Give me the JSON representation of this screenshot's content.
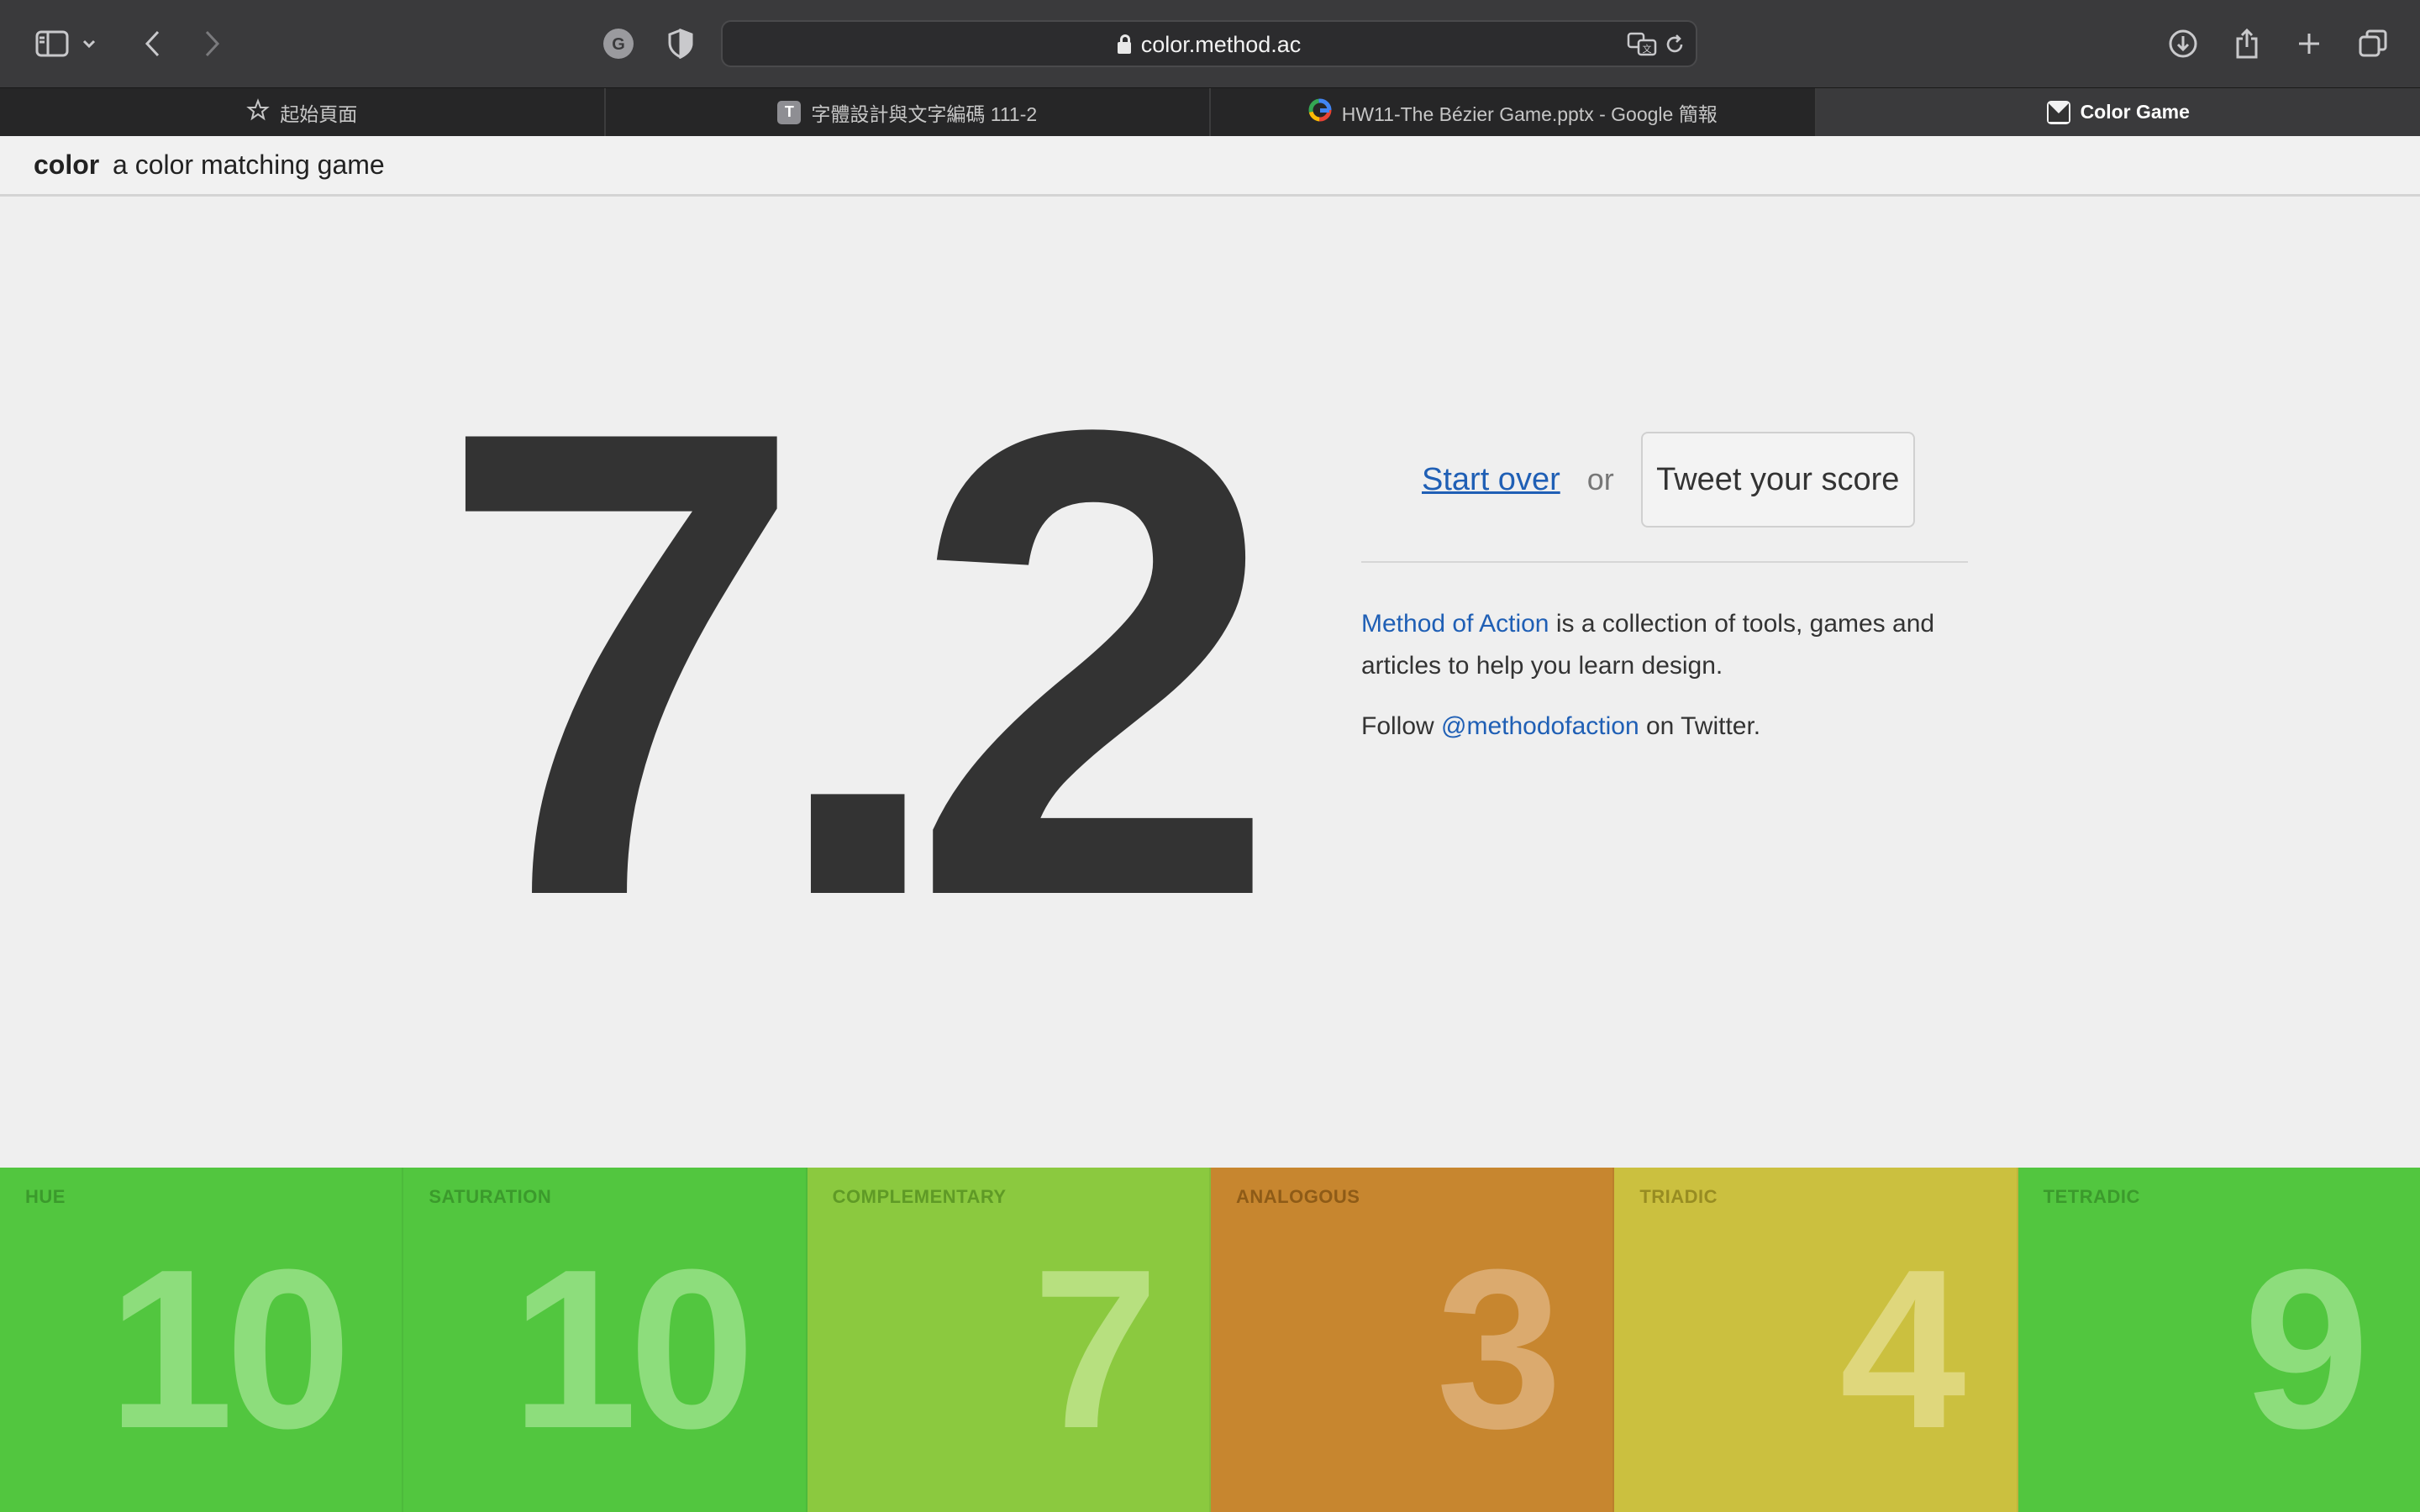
{
  "browser": {
    "url": "color.method.ac",
    "tabs": [
      {
        "label": "起始頁面",
        "icon": "star-icon",
        "active": false
      },
      {
        "label": "字體設計與文字編碼 111-2",
        "icon": "t-favicon",
        "active": false
      },
      {
        "label": "HW11-The Bézier Game.pptx - Google 簡報",
        "icon": "google-favicon",
        "active": false
      },
      {
        "label": "Color Game",
        "icon": "method-favicon",
        "active": true
      }
    ]
  },
  "header": {
    "brand": "color",
    "tagline": "a color matching game"
  },
  "score": "7.2",
  "actions": {
    "start_over": "Start over",
    "or": "or",
    "tweet": "Tweet your score"
  },
  "about": {
    "link": "Method of Action",
    "text": " is a collection of tools, games and articles to help you learn design."
  },
  "follow": {
    "prefix": "Follow ",
    "handle": "@methodofaction",
    "suffix": " on Twitter."
  },
  "tiles": [
    {
      "label": "HUE",
      "value": "10",
      "bg": "#52c63f",
      "label_color": "#3b9a2c",
      "value_color": "#8ddd7c"
    },
    {
      "label": "SATURATION",
      "value": "10",
      "bg": "#52c63f",
      "label_color": "#3b9a2c",
      "value_color": "#8ddd7c"
    },
    {
      "label": "COMPLEMENTARY",
      "value": "7",
      "bg": "#8bc93f",
      "label_color": "#5f9a26",
      "value_color": "#b7e07f"
    },
    {
      "label": "ANALOGOUS",
      "value": "3",
      "bg": "#c7862f",
      "label_color": "#8e5b17",
      "value_color": "#dbaa6e"
    },
    {
      "label": "TRIADIC",
      "value": "4",
      "bg": "#cbc03f",
      "label_color": "#978c22",
      "value_color": "#dfd77c"
    },
    {
      "label": "TETRADIC",
      "value": "9",
      "bg": "#52c63f",
      "label_color": "#3b9a2c",
      "value_color": "#8ddd7c"
    }
  ]
}
